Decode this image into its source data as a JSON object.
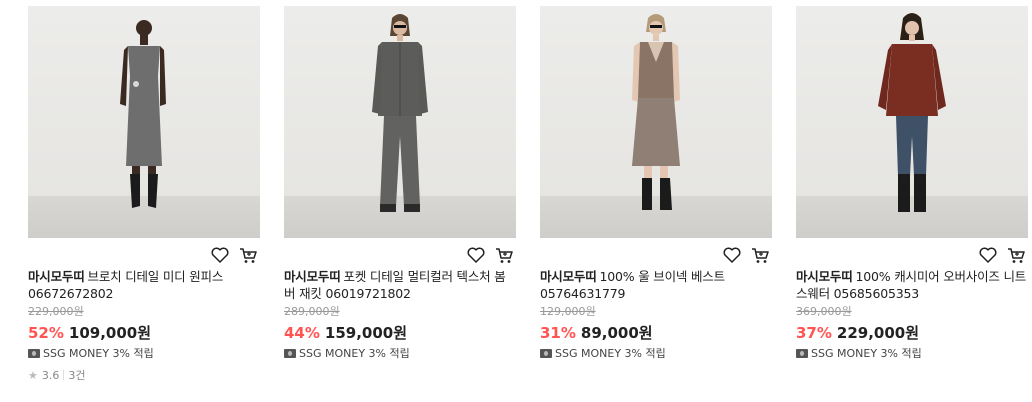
{
  "products": [
    {
      "brand": "마시모두띠",
      "name": "브로치 디테일 미디 원피스 06672672802",
      "original_price": "229,000원",
      "discount": "52%",
      "price": "109,000원",
      "ssg_money": "SSG MONEY 3% 적립",
      "rating": "3.6",
      "review_count": "3건",
      "colors": {
        "garment": "#6e6e6e",
        "boots": "#1b1b1b",
        "skin": "#3a2a22"
      }
    },
    {
      "brand": "마시모두띠",
      "name": "포켓 디테일 멀티컬러 텍스처 봄버 재킷 06019721802",
      "original_price": "289,000원",
      "discount": "44%",
      "price": "159,000원",
      "ssg_money": "SSG MONEY 3% 적립",
      "colors": {
        "garment": "#5c5c5a",
        "boots": "#2a2a2a",
        "skin": "#d9b9a0"
      }
    },
    {
      "brand": "마시모두띠",
      "name": "100% 울 브이넥 베스트 05764631779",
      "original_price": "129,000원",
      "discount": "31%",
      "price": "89,000원",
      "ssg_money": "SSG MONEY 3% 적립",
      "colors": {
        "garment": "#8a7465",
        "boots": "#1b1b1b",
        "skin": "#e4c7b2"
      }
    },
    {
      "brand": "마시모두띠",
      "name": "100% 캐시미어 오버사이즈 니트 스웨터 05685605353",
      "original_price": "369,000원",
      "discount": "37%",
      "price": "229,000원",
      "ssg_money": "SSG MONEY 3% 적립",
      "colors": {
        "garment": "#7a2e22",
        "boots": "#1b1b1b",
        "skin": "#e2c2ad"
      }
    }
  ],
  "icons": {
    "wishlist": "heart-icon",
    "cart": "cart-icon",
    "money": "ssg-money-icon",
    "rating": "star-icon"
  },
  "accent": {
    "discount": "#ff5452"
  }
}
